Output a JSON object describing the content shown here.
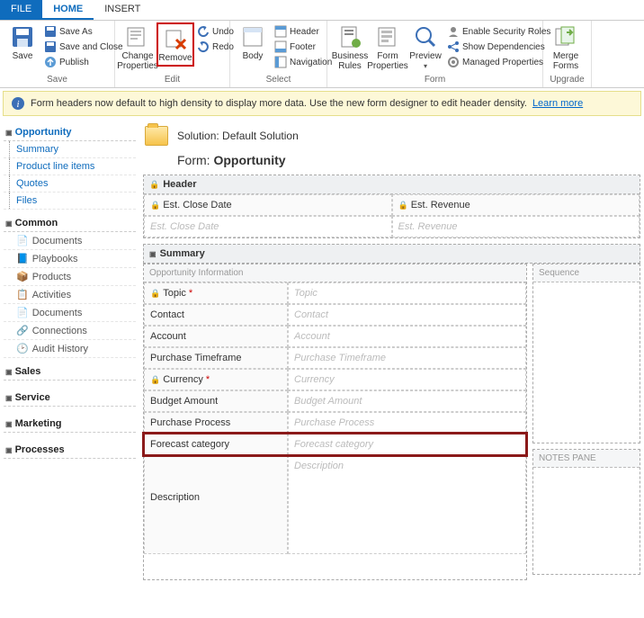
{
  "tabs": {
    "file": "FILE",
    "home": "HOME",
    "insert": "INSERT"
  },
  "ribbon": {
    "save": {
      "save": "Save",
      "saveAs": "Save As",
      "saveClose": "Save and Close",
      "publish": "Publish",
      "group": "Save"
    },
    "edit": {
      "changeProps": "Change\nProperties",
      "remove": "Remove",
      "undo": "Undo",
      "redo": "Redo",
      "group": "Edit"
    },
    "select": {
      "body": "Body",
      "header": "Header",
      "footer": "Footer",
      "nav": "Navigation",
      "group": "Select"
    },
    "form": {
      "bizRules": "Business\nRules",
      "formProps": "Form\nProperties",
      "preview": "Preview",
      "security": "Enable Security Roles",
      "deps": "Show Dependencies",
      "managed": "Managed Properties",
      "group": "Form"
    },
    "upgrade": {
      "merge": "Merge\nForms",
      "group": "Upgrade"
    }
  },
  "infoBar": {
    "text": "Form headers now default to high density to display more data. Use the new form designer to edit header density.",
    "link": "Learn more"
  },
  "nav": {
    "opportunity": {
      "title": "Opportunity",
      "items": [
        "Summary",
        "Product line items",
        "Quotes",
        "Files"
      ]
    },
    "common": {
      "title": "Common",
      "items": [
        "Documents",
        "Playbooks",
        "Products",
        "Activities",
        "Documents",
        "Connections",
        "Audit History"
      ]
    },
    "sales": "Sales",
    "service": "Service",
    "marketing": "Marketing",
    "processes": "Processes"
  },
  "solution": {
    "label": "Solution:",
    "name": "Default Solution",
    "formLabel": "Form:",
    "formName": "Opportunity"
  },
  "header": {
    "title": "Header",
    "estClose": "Est. Close Date",
    "estRev": "Est. Revenue"
  },
  "summary": {
    "title": "Summary",
    "oppInfo": "Opportunity Information",
    "sequence": "Sequence",
    "notesPane": "NOTES PANE",
    "fields": {
      "topic": "Topic",
      "contact": "Contact",
      "account": "Account",
      "timeframe": "Purchase Timeframe",
      "currency": "Currency",
      "budget": "Budget Amount",
      "process": "Purchase Process",
      "forecast": "Forecast category",
      "description": "Description"
    }
  }
}
